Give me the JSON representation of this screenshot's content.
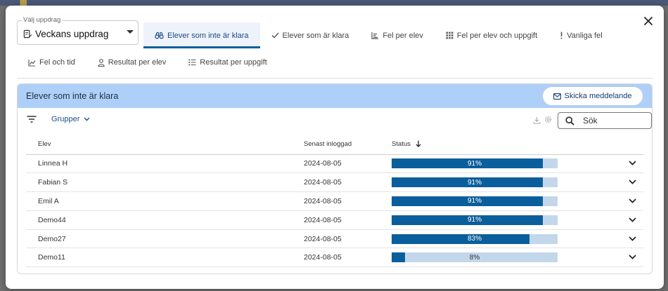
{
  "select": {
    "label": "Välj uppdrag",
    "value": "Veckans uppdrag"
  },
  "tabs_row1": [
    {
      "label": "Elever som inte är klara",
      "icon": "binoculars-icon",
      "active": true
    },
    {
      "label": "Elever som är klara",
      "icon": "check-icon",
      "active": false
    },
    {
      "label": "Fel per elev",
      "icon": "bar-chart-icon",
      "active": false
    },
    {
      "label": "Fel per elev och uppgift",
      "icon": "grid-icon",
      "active": false
    },
    {
      "label": "Vanliga fel",
      "icon": "exclamation-icon",
      "active": false
    }
  ],
  "tabs_row2": [
    {
      "label": "Fel och tid",
      "icon": "line-chart-icon"
    },
    {
      "label": "Resultat per elev",
      "icon": "person-icon"
    },
    {
      "label": "Resultat per uppgift",
      "icon": "list-icon"
    }
  ],
  "panel": {
    "title": "Elever som inte är klara",
    "send_button": "Skicka meddelande",
    "groups_label": "Grupper",
    "search_placeholder": "Sök"
  },
  "table": {
    "headers": [
      "Elev",
      "Senast inloggad",
      "Status"
    ],
    "rows": [
      {
        "name": "Linnea H",
        "date": "2024-08-05",
        "status": 91,
        "status_label": "91%"
      },
      {
        "name": "Fabian S",
        "date": "2024-08-05",
        "status": 91,
        "status_label": "91%"
      },
      {
        "name": "Emil A",
        "date": "2024-08-05",
        "status": 91,
        "status_label": "91%"
      },
      {
        "name": "Demo44",
        "date": "2024-08-05",
        "status": 91,
        "status_label": "91%"
      },
      {
        "name": "Demo27",
        "date": "2024-08-05",
        "status": 83,
        "status_label": "83%"
      },
      {
        "name": "Demo11",
        "date": "2024-08-05",
        "status": 8,
        "status_label": "8%"
      }
    ]
  },
  "colors": {
    "accent": "#0b5e9c",
    "bar_track": "#c2d7ea",
    "panel_header": "#aed0f8"
  }
}
